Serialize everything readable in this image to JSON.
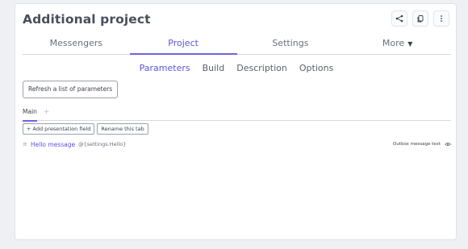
{
  "page": {
    "title": "Additional project"
  },
  "actions": {
    "share_icon": "share-icon",
    "copy_icon": "copy-icon",
    "more_icon": "vertical-dots-icon"
  },
  "main_tabs": [
    {
      "label": "Messengers",
      "active": false
    },
    {
      "label": "Project",
      "active": true
    },
    {
      "label": "Settings",
      "active": false
    },
    {
      "label": "More",
      "active": false,
      "dropdown": true
    }
  ],
  "sub_tabs": [
    {
      "label": "Parameters",
      "active": true
    },
    {
      "label": "Build",
      "active": false
    },
    {
      "label": "Description",
      "active": false
    },
    {
      "label": "Options",
      "active": false
    }
  ],
  "refresh_label": "Refresh a list of parameters",
  "inner_tabs": [
    {
      "label": "Main",
      "active": true
    }
  ],
  "inner_add": "+",
  "buttons": {
    "add_field": "+ Add presentation field",
    "rename_tab": "Rename this tab"
  },
  "fields": [
    {
      "name": "Hello message",
      "variable": "@{settings.Hello}",
      "type": "Outbox message text"
    }
  ],
  "colors": {
    "accent": "#5b55d9",
    "background": "#eef0f4",
    "card": "#ffffff"
  }
}
